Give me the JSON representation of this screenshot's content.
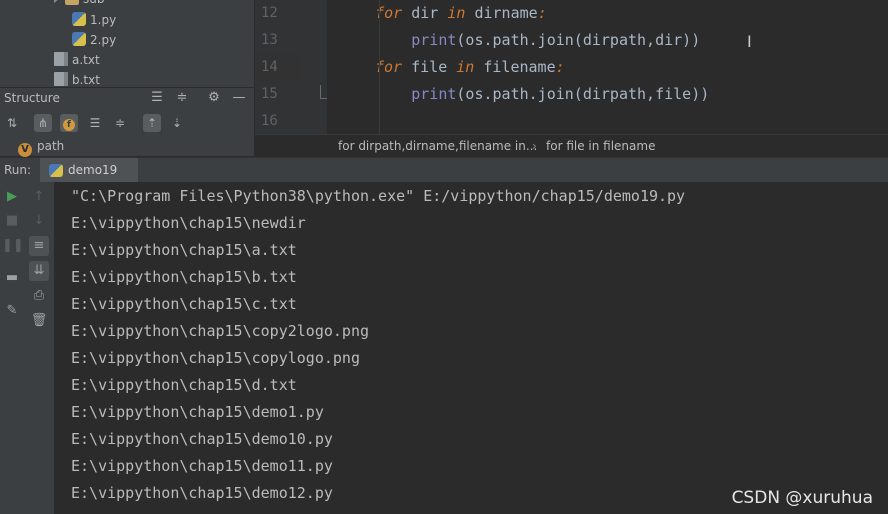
{
  "project_tree": {
    "items": [
      {
        "label": "sub",
        "type": "folder"
      },
      {
        "label": "1.py",
        "type": "py"
      },
      {
        "label": "2.py",
        "type": "py"
      },
      {
        "label": "a.txt",
        "type": "txt"
      },
      {
        "label": "b.txt",
        "type": "txt"
      }
    ]
  },
  "structure": {
    "title": "Structure",
    "item": {
      "badge": "V",
      "label": "path"
    }
  },
  "editor": {
    "lines": [
      {
        "number": "12",
        "indent": "    ",
        "kw": "for",
        "a": " dir ",
        "kw2": "in",
        "b": " dirname",
        "colon": ":"
      },
      {
        "number": "13",
        "indent": "        ",
        "fn": "print",
        "rest": "(os.path.join(dirpath,dir))"
      },
      {
        "number": "14",
        "indent": "",
        "kw": "for",
        "a": " file ",
        "kw2": "in",
        "b": " filename",
        "colon": ":"
      },
      {
        "number": "15",
        "indent": "        ",
        "fn": "print",
        "rest": "(os.path.join(dirpath,file))"
      },
      {
        "number": "16"
      }
    ],
    "breadcrumb": [
      "for dirpath,dirname,filename in...",
      "for file in filename"
    ]
  },
  "run": {
    "label": "Run:",
    "tab": "demo19",
    "output": [
      "\"C:\\Program Files\\Python38\\python.exe\" E:/vippython/chap15/demo19.py",
      "E:\\vippython\\chap15\\newdir",
      "E:\\vippython\\chap15\\a.txt",
      "E:\\vippython\\chap15\\b.txt",
      "E:\\vippython\\chap15\\c.txt",
      "E:\\vippython\\chap15\\copy2logo.png",
      "E:\\vippython\\chap15\\copylogo.png",
      "E:\\vippython\\chap15\\d.txt",
      "E:\\vippython\\chap15\\demo1.py",
      "E:\\vippython\\chap15\\demo10.py",
      "E:\\vippython\\chap15\\demo11.py",
      "E:\\vippython\\chap15\\demo12.py"
    ]
  },
  "watermark": "CSDN @xuruhua",
  "colors": {
    "keyword": "#cc7832",
    "builtin": "#8888c6",
    "text": "#a9b7c6",
    "run_green": "#499c54"
  }
}
